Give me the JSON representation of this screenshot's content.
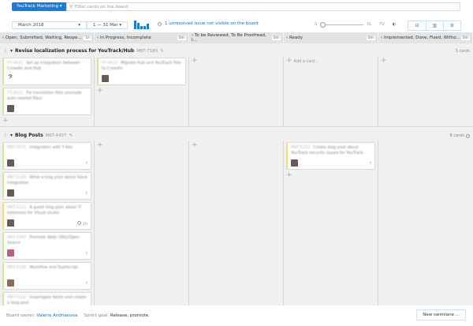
{
  "header": {
    "project": "YouTrack Marketing",
    "search_placeholder": "Filter cards on the board",
    "sprint": "March 2018",
    "range": "1 — 31 Mar",
    "unresolved": "1 unresolved issue not visible on the board",
    "size_min": "S",
    "size_max": "XL",
    "tv": "TV"
  },
  "columns": [
    {
      "label": "Open, Submitted, Waiting, Reope...",
      "wip": "1h"
    },
    {
      "label": "In Progress, Incomplete",
      "wip": "0m"
    },
    {
      "label": "To be Reviewed, To Be Proofread, I...",
      "wip": "0m"
    },
    {
      "label": "Ready",
      "wip": "0m"
    },
    {
      "label": "Implemented, Done, Fixed, Witho...",
      "wip": "0m"
    }
  ],
  "lanes": [
    {
      "title": "Revise localization process for YouTrack/Hub",
      "id": "MKT-7180",
      "count": "3 cards",
      "add_card": "Add a card...",
      "cards": [
        {
          "id": "YT-4021",
          "title": "Set up integration between Crowdin and Hub"
        },
        {
          "id": "YT-4022",
          "title": "Fix translation files (exclude auto-related files)"
        },
        {
          "id": "YT-4023",
          "title": "Migrate Hub and YouTrack files to Crowdin"
        }
      ]
    },
    {
      "title": "Blog Posts",
      "id": "MKT-4497",
      "count": "8 cards",
      "cards": [
        {
          "id": "MKT-5071",
          "title": "Integration with T-Rex",
          "est": "?"
        },
        {
          "id": "MKT-5105",
          "title": "Write a blog post about Slack integration",
          "est": "?"
        },
        {
          "id": "MKT-5121",
          "title": "A guest blog post about IT extension for Visual studio",
          "est": "1h"
        },
        {
          "id": "MKT-5047",
          "title": "Promote Webr DRG/Open Search",
          "est": "?"
        },
        {
          "id": "MKT-5106",
          "title": "Workflow and TypeScript",
          "est": "?"
        },
        {
          "id": "MKT-5152",
          "title": "Investigate Kotlin and create a blog post",
          "est": ""
        },
        {
          "id": "MKT-5163",
          "title": "Create blog post about YouTrack security issues for YouTrack",
          "est": "?"
        }
      ]
    }
  ],
  "footer": {
    "owner_label": "Board owner:",
    "owner": "Valerie Andrianova",
    "goal_label": "Sprint goal:",
    "goal": "Release, promote.",
    "new_swimlane": "New swimlane ..."
  }
}
